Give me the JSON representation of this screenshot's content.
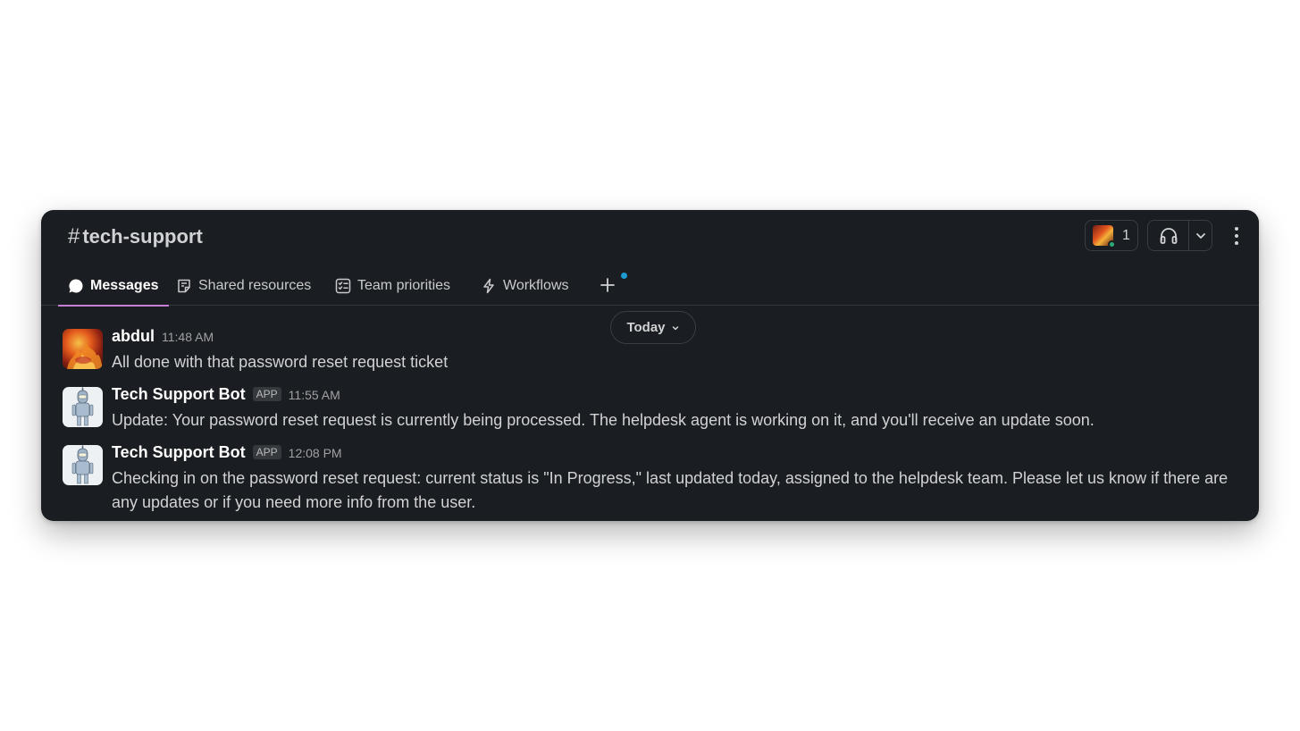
{
  "channel": {
    "hash": "#",
    "name": "tech-support"
  },
  "header": {
    "member_count": "1",
    "icons": {
      "members_avatar": "avatar",
      "huddle": "headphones-icon",
      "caret": "chevron-down-icon",
      "more": "kebab-icon"
    }
  },
  "tabs": [
    {
      "label": "Messages",
      "icon": "message-bubble-icon",
      "active": true
    },
    {
      "label": "Shared resources",
      "icon": "canvas-note-icon",
      "active": false
    },
    {
      "label": "Team priorities",
      "icon": "list-checklist-icon",
      "active": false
    },
    {
      "label": "Workflows",
      "icon": "lightning-icon",
      "active": false
    }
  ],
  "date_divider": {
    "label": "Today"
  },
  "messages": [
    {
      "author": "abdul",
      "time": "11:48 AM",
      "app_badge": "",
      "text": "All done with that password reset request ticket"
    },
    {
      "author": "Tech Support Bot",
      "time": "11:55 AM",
      "app_badge": "APP",
      "text": "Update: Your password reset request is currently being processed. The helpdesk agent is working on it, and you'll receive an update soon."
    },
    {
      "author": "Tech Support Bot",
      "time": "12:08 PM",
      "app_badge": "APP",
      "text": "Checking in on the password reset request: current status is \"In Progress,\" last updated today, assigned to the helpdesk team. Please let us know if there are any updates or if you need more info from the user."
    }
  ],
  "colors": {
    "window_bg": "#1a1d21",
    "active_tab_underline": "#c77fd6",
    "presence": "#2bac76",
    "notification_dot": "#1d9bd1"
  }
}
